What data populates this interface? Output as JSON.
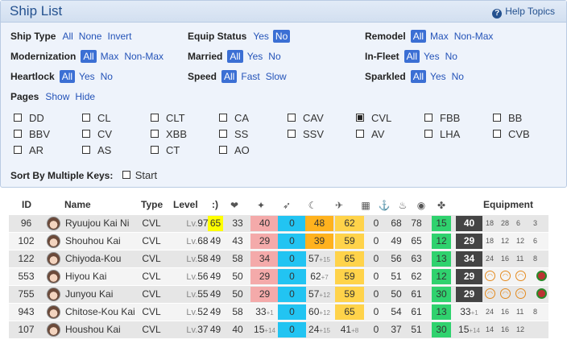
{
  "panel": {
    "title": "Ship List",
    "help_label": "Help Topics",
    "filters": {
      "ship_type": {
        "label": "Ship Type",
        "options": [
          "All",
          "None",
          "Invert"
        ],
        "selected": ""
      },
      "equip_status": {
        "label": "Equip Status",
        "options": [
          "Yes",
          "No"
        ],
        "selected": "No"
      },
      "remodel": {
        "label": "Remodel",
        "options": [
          "All",
          "Max",
          "Non-Max"
        ],
        "selected": "All"
      },
      "modernization": {
        "label": "Modernization",
        "options": [
          "All",
          "Max",
          "Non-Max"
        ],
        "selected": "All"
      },
      "married": {
        "label": "Married",
        "options": [
          "All",
          "Yes",
          "No"
        ],
        "selected": "All"
      },
      "in_fleet": {
        "label": "In-Fleet",
        "options": [
          "All",
          "Yes",
          "No"
        ],
        "selected": "All"
      },
      "heartlock": {
        "label": "Heartlock",
        "options": [
          "All",
          "Yes",
          "No"
        ],
        "selected": "All"
      },
      "speed": {
        "label": "Speed",
        "options": [
          "All",
          "Fast",
          "Slow"
        ],
        "selected": "All"
      },
      "sparkled": {
        "label": "Sparkled",
        "options": [
          "All",
          "Yes",
          "No"
        ],
        "selected": "All"
      },
      "pages": {
        "label": "Pages",
        "options": [
          "Show",
          "Hide"
        ],
        "selected": ""
      }
    },
    "ship_types": [
      [
        "DD",
        "CL",
        "CLT",
        "CA",
        "CAV",
        "CVL",
        "FBB",
        "BB"
      ],
      [
        "BBV",
        "CV",
        "XBB",
        "SS",
        "SSV",
        "AV",
        "LHA",
        "CVB"
      ],
      [
        "AR",
        "AS",
        "CT",
        "AO"
      ]
    ],
    "checked_types": [
      "CVL"
    ],
    "sort": {
      "label": "Sort By Multiple Keys:",
      "start_label": "Start"
    }
  },
  "table": {
    "headers": {
      "id": "ID",
      "name": "Name",
      "type": "Type",
      "level": "Level",
      "cond": ":)",
      "equipment": "Equipment"
    },
    "header_icons": [
      "hp-icon",
      "firepower-icon",
      "torpedo-icon",
      "night-battle-icon",
      "anti-air-icon",
      "armor-icon",
      "asw-icon",
      "evasion-icon",
      "los-icon",
      "luck-icon"
    ],
    "header_glyphs": [
      "❤",
      "✦",
      "➶",
      "☾",
      "✈",
      "▦",
      "⚓",
      "♨",
      "◉",
      "✤"
    ],
    "level_prefix": "Lv.",
    "rows": [
      {
        "id": "96",
        "name": "Ryuujou Kai Ni",
        "type": "CVL",
        "level": "97",
        "cond": "65",
        "hp": "33",
        "fp": "40",
        "fp_b": "",
        "tp": "0",
        "tp_b": "",
        "nb": "48",
        "nb_b": "",
        "aa": "62",
        "aa_b": "",
        "ar": "0",
        "as": "68",
        "ev": "78",
        "los": "15",
        "lk": "40",
        "lk_b": "",
        "eq": [
          "18",
          "28",
          "6",
          "3"
        ]
      },
      {
        "id": "102",
        "name": "Shouhou Kai",
        "type": "CVL",
        "level": "68",
        "cond": "49",
        "hp": "43",
        "fp": "29",
        "fp_b": "",
        "tp": "0",
        "tp_b": "",
        "nb": "39",
        "nb_b": "",
        "aa": "59",
        "aa_b": "",
        "ar": "0",
        "as": "49",
        "ev": "65",
        "los": "12",
        "lk": "29",
        "lk_b": "",
        "eq": [
          "18",
          "12",
          "12",
          "6"
        ]
      },
      {
        "id": "122",
        "name": "Chiyoda-Kou",
        "type": "CVL",
        "level": "58",
        "cond": "49",
        "hp": "58",
        "fp": "34",
        "fp_b": "",
        "tp": "0",
        "tp_b": "",
        "nb": "57",
        "nb_b": "+15",
        "aa": "65",
        "aa_b": "",
        "ar": "0",
        "as": "56",
        "ev": "63",
        "los": "13",
        "lk": "34",
        "lk_b": "",
        "eq": [
          "24",
          "16",
          "11",
          "8"
        ]
      },
      {
        "id": "553",
        "name": "Hiyou Kai",
        "type": "CVL",
        "level": "56",
        "cond": "49",
        "hp": "50",
        "fp": "29",
        "fp_b": "",
        "tp": "0",
        "tp_b": "",
        "nb": "62",
        "nb_b": "+7",
        "aa": "59",
        "aa_b": "",
        "ar": "0",
        "as": "51",
        "ev": "62",
        "los": "12",
        "lk": "29",
        "lk_b": "",
        "eq": []
      },
      {
        "id": "755",
        "name": "Junyou Kai",
        "type": "CVL",
        "level": "55",
        "cond": "49",
        "hp": "50",
        "fp": "29",
        "fp_b": "",
        "tp": "0",
        "tp_b": "",
        "nb": "57",
        "nb_b": "+12",
        "aa": "59",
        "aa_b": "",
        "ar": "0",
        "as": "50",
        "ev": "61",
        "los": "30",
        "lk": "29",
        "lk_b": "",
        "eq": []
      },
      {
        "id": "943",
        "name": "Chitose-Kou Kai",
        "type": "CVL",
        "level": "52",
        "cond": "49",
        "hp": "58",
        "fp": "33",
        "fp_b": "+1",
        "tp": "0",
        "tp_b": "",
        "nb": "60",
        "nb_b": "+12",
        "aa": "65",
        "aa_b": "",
        "ar": "0",
        "as": "54",
        "ev": "61",
        "los": "13",
        "lk": "33",
        "lk_b": "+1",
        "eq": [
          "24",
          "16",
          "11",
          "8"
        ]
      },
      {
        "id": "107",
        "name": "Houshou Kai",
        "type": "CVL",
        "level": "37",
        "cond": "49",
        "hp": "40",
        "fp": "15",
        "fp_b": "+14",
        "tp": "0",
        "tp_b": "",
        "nb": "24",
        "nb_b": "+15",
        "aa": "41",
        "aa_b": "+8",
        "ar": "0",
        "as": "37",
        "ev": "51",
        "los": "30",
        "lk": "15",
        "lk_b": "+14",
        "eq": [
          "14",
          "16",
          "12"
        ]
      }
    ]
  },
  "colors": {
    "selected_option": "#3b6fd4",
    "link": "#2453b8",
    "title": "#24518f",
    "cond_sparkle": "#ffff00",
    "firepower": "#f4aaaa",
    "torpedo": "#22c4f2",
    "night_battle": "#ffb21e",
    "anti_air": "#ffd34a",
    "los": "#2fd26e",
    "luck": "#444444"
  }
}
